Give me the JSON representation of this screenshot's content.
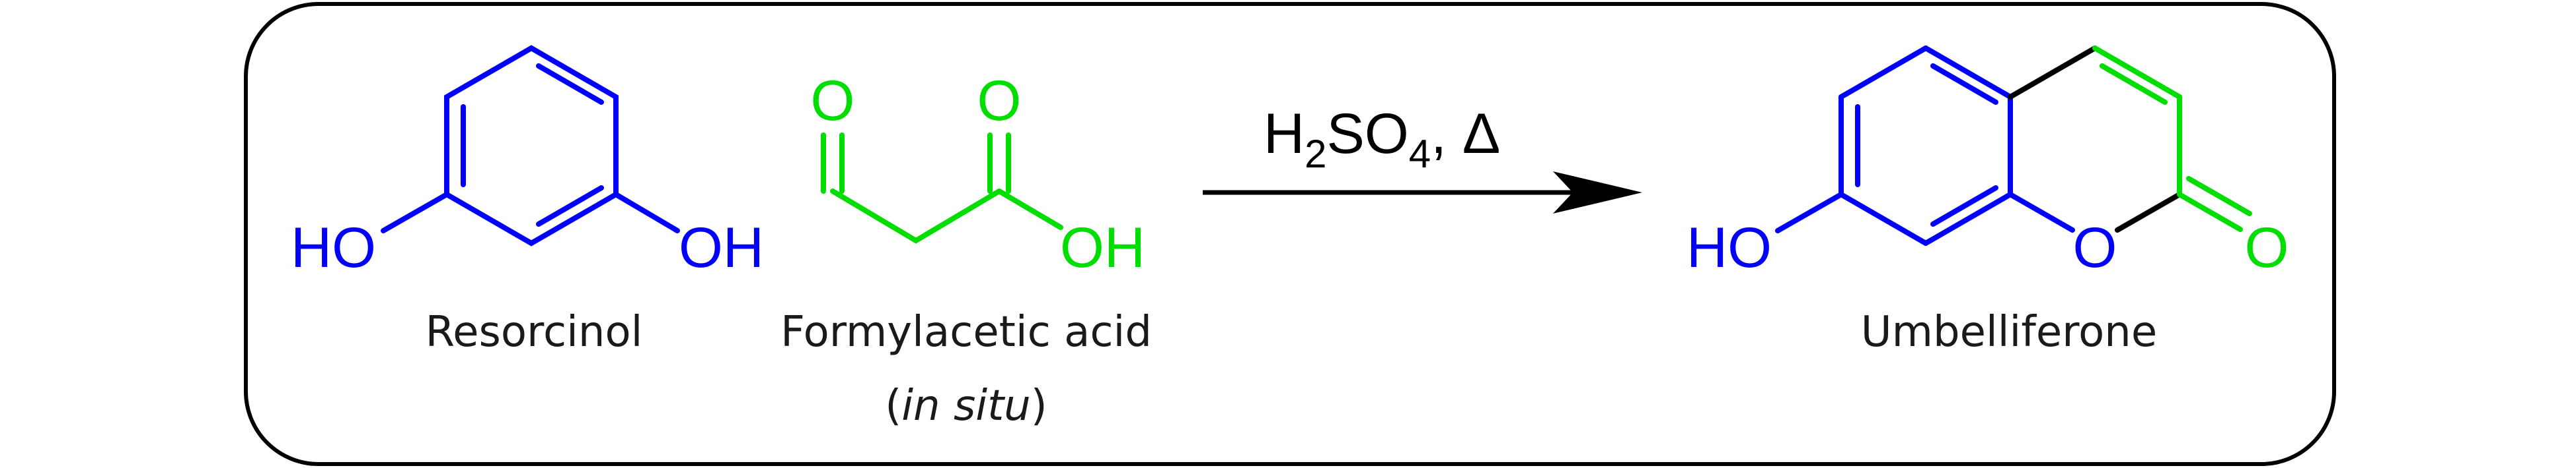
{
  "colors": {
    "resorcinol": "#0000ff",
    "formylacetic": "#00dd00",
    "new_bond": "#000000",
    "frame": "#000000"
  },
  "resorcinol": {
    "name": "Resorcinol",
    "oh_left": "HO",
    "oh_right": "OH"
  },
  "formylacetic_acid": {
    "name": "Formylacetic acid",
    "note_open": "(",
    "note_italic": "in situ",
    "note_close": ")",
    "o_aldehyde": "O",
    "o_carbonyl": "O",
    "oh": "OH"
  },
  "arrow": {
    "reagent_h": "H",
    "reagent_sub2": "2",
    "reagent_so": "SO",
    "reagent_sub4": "4",
    "reagent_rest": ", Δ"
  },
  "umbelliferone": {
    "name": "Umbelliferone",
    "oh": "HO",
    "ring_o": "O",
    "carbonyl_o": "O"
  }
}
